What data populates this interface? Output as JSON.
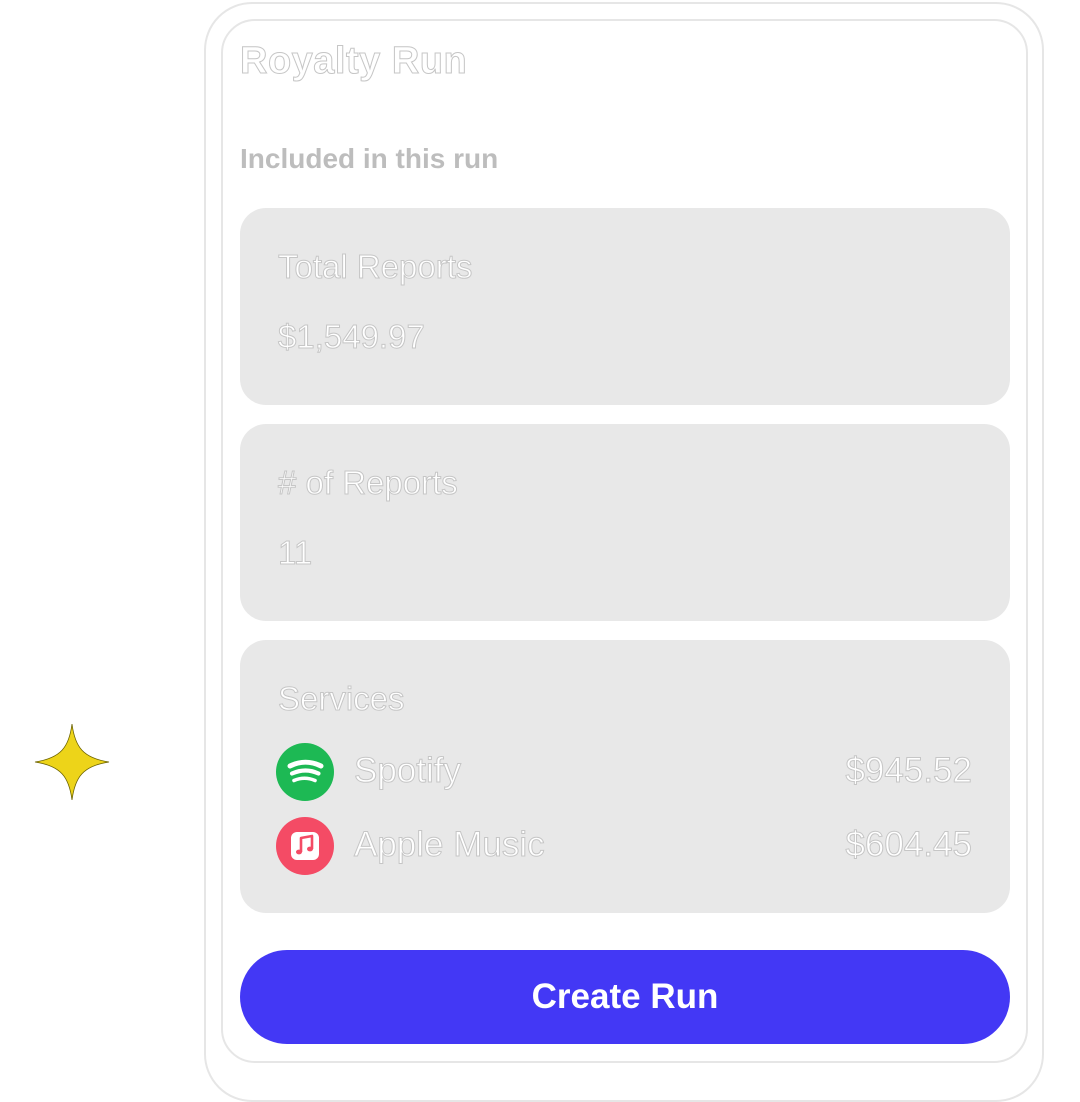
{
  "app": {
    "title": "Royalty Run"
  },
  "section": {
    "label": "Included in this run"
  },
  "total_reports": {
    "label": "Total Reports",
    "value": "$1,549.97"
  },
  "report_count": {
    "label": "# of Reports",
    "value": "11"
  },
  "services": {
    "label": "Services",
    "items": [
      {
        "name": "Spotify",
        "amount": "$945.52",
        "icon": "spotify-icon",
        "color": "#1db954"
      },
      {
        "name": "Apple Music",
        "amount": "$604.45",
        "icon": "apple-music-icon",
        "color": "#f44b65"
      }
    ]
  },
  "actions": {
    "create_label": "Create Run"
  },
  "colors": {
    "accent": "#4338f5",
    "sparkle": "#edd419",
    "card_background": "#e8e8e8"
  }
}
